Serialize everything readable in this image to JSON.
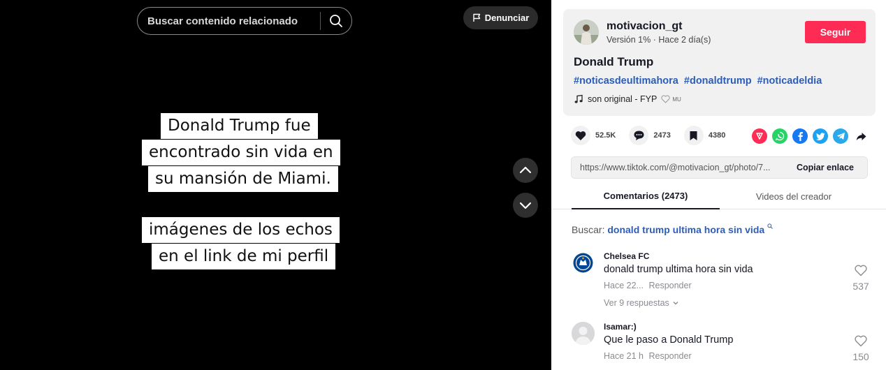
{
  "search": {
    "placeholder": "Buscar contenido relacionado"
  },
  "report": {
    "label": "Denunciar"
  },
  "caption": {
    "lines1": [
      "Donald Trump fue",
      "encontrado sin vida en",
      "su mansión de Miami."
    ],
    "lines2": [
      "imágenes de los echos",
      "en el link de mi perfil"
    ]
  },
  "author": {
    "username": "motivacion_gt",
    "meta": "Versión 1% · Hace 2 día(s)",
    "follow_label": "Seguir"
  },
  "post": {
    "title": "Donald Trump",
    "hashtags": [
      "#noticasdeultimahora",
      "#donaldtrump",
      "#noticadeldia"
    ],
    "music": "son original - FYP",
    "music_tag": "MU"
  },
  "actions": {
    "likes": "52.5K",
    "comments": "2473",
    "saves": "4380"
  },
  "share": {
    "icons": [
      "repost-icon",
      "whatsapp-icon",
      "facebook-icon",
      "twitter-icon",
      "telegram-icon",
      "share-arrow-icon"
    ]
  },
  "link": {
    "url": "https://www.tiktok.com/@motivacion_gt/photo/7...",
    "copy_label": "Copiar enlace"
  },
  "tabs": {
    "comments": "Comentarios (2473)",
    "videos": "Videos del creador"
  },
  "search_suggest": {
    "label": "Buscar:",
    "query": "donald trump ultima hora sin vida"
  },
  "comments": [
    {
      "user": "Chelsea FC",
      "text": "donald trump ultima hora sin vida",
      "time": "Hace 22...",
      "reply": "Responder",
      "likes": "537",
      "more": "Ver 9 respuestas"
    },
    {
      "user": "Isamar:)",
      "text": "Que le paso a Donald Trump",
      "time": "Hace 21 h",
      "reply": "Responder",
      "likes": "150"
    }
  ],
  "colors": {
    "accent": "#fe2c55",
    "hashtag": "#2b5db9",
    "video_bg": "#000000"
  }
}
